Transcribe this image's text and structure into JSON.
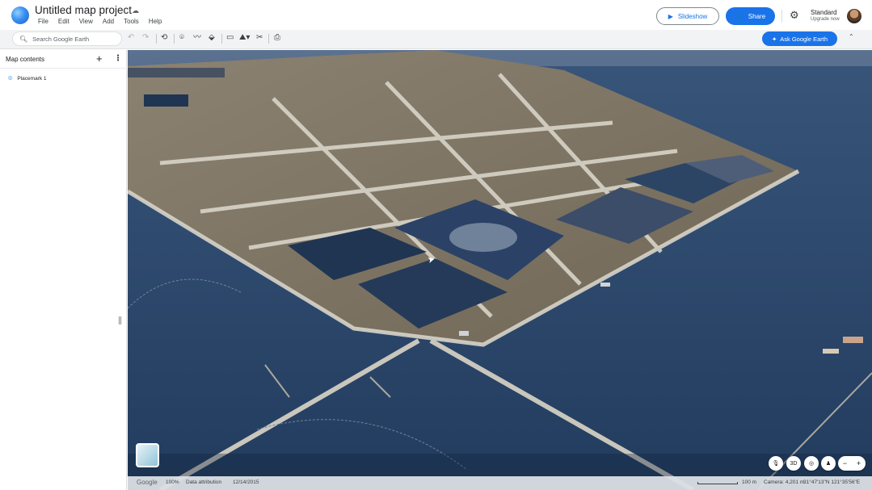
{
  "header": {
    "title": "Untitled map project",
    "menu": [
      "File",
      "Edit",
      "View",
      "Add",
      "Tools",
      "Help"
    ],
    "slideshow_label": "Slideshow",
    "share_label": "Share",
    "plan_name": "Standard",
    "plan_upgrade": "Upgrade now"
  },
  "toolbar": {
    "search_placeholder": "Search Google Earth",
    "ask_label": "Ask Google Earth"
  },
  "sidebar": {
    "title": "Map contents",
    "items": [
      {
        "label": "Placemark 1",
        "icon": "placemark-pin-icon"
      }
    ]
  },
  "map": {
    "controls": [
      "mic-icon",
      "3D",
      "compass-orbit-icon",
      "person-icon"
    ],
    "view_3d_label": "3D"
  },
  "status": {
    "brand": "Google",
    "zoom": "100%",
    "attribution": "Data attribution",
    "date": "12/14/2015",
    "scale": "100 m",
    "camera": "Camera: 4,201 m",
    "coords": "31°47'13\"N 121°35'56\"E"
  },
  "colors": {
    "accent": "#1a73e8",
    "water": "#2e4a6e",
    "land": "#8a7f6d"
  }
}
